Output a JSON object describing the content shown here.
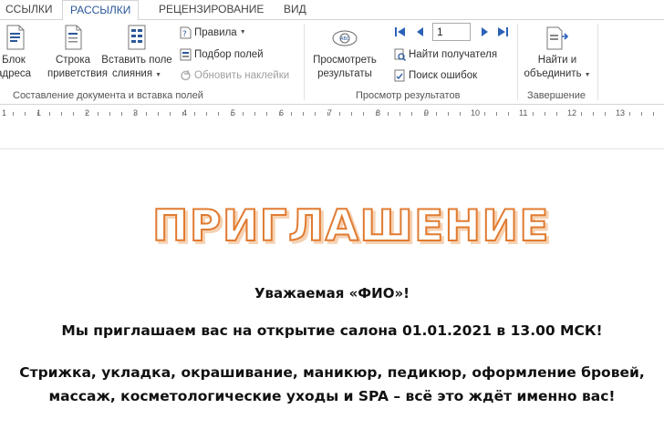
{
  "tabs": [
    {
      "label": "ССЫЛКИ",
      "active": false
    },
    {
      "label": "РАССЫЛКИ",
      "active": true
    },
    {
      "label": "РЕЦЕНЗИРОВАНИЕ",
      "active": false
    },
    {
      "label": "ВИД",
      "active": false
    }
  ],
  "ribbon": {
    "group1": {
      "label": "Составление документа и вставка полей",
      "address_block": {
        "line1": "Блок",
        "line2": "адреса"
      },
      "greeting_line": {
        "line1": "Строка",
        "line2": "приветствия"
      },
      "insert_field": {
        "line1": "Вставить поле",
        "line2": "слияния"
      },
      "rules": "Правила",
      "match_fields": "Подбор полей",
      "update_labels": "Обновить наклейки"
    },
    "group2": {
      "label": "Просмотр результатов",
      "preview_results": {
        "line1": "Просмотреть",
        "line2": "результаты"
      },
      "record_number": "1",
      "find_recipient": "Найти получателя",
      "check_errors": "Поиск ошибок"
    },
    "group3": {
      "label": "Завершение",
      "finish_merge": {
        "line1": "Найти и",
        "line2": "объединить"
      }
    }
  },
  "ruler": {
    "numbers": [
      "1",
      "1",
      "2",
      "3",
      "4",
      "5",
      "6",
      "7",
      "8",
      "9",
      "10",
      "11",
      "12",
      "13"
    ]
  },
  "document": {
    "title": "ПРИГЛАШЕНИЕ",
    "greeting": "Уважаемая «ФИО»!",
    "invite": "Мы приглашаем вас на открытие салона 01.01.2021 в 13.00 МСК!",
    "services_line1": "Стрижка, укладка, окрашивание, маникюр, педикюр, оформление бровей,",
    "services_line2": "массаж, косметологические уходы и SPA – всё это ждёт именно вас!"
  },
  "colors": {
    "accent_blue": "#2b579a",
    "title_outline": "#e07b32",
    "nav_blue": "#2b62b8"
  }
}
